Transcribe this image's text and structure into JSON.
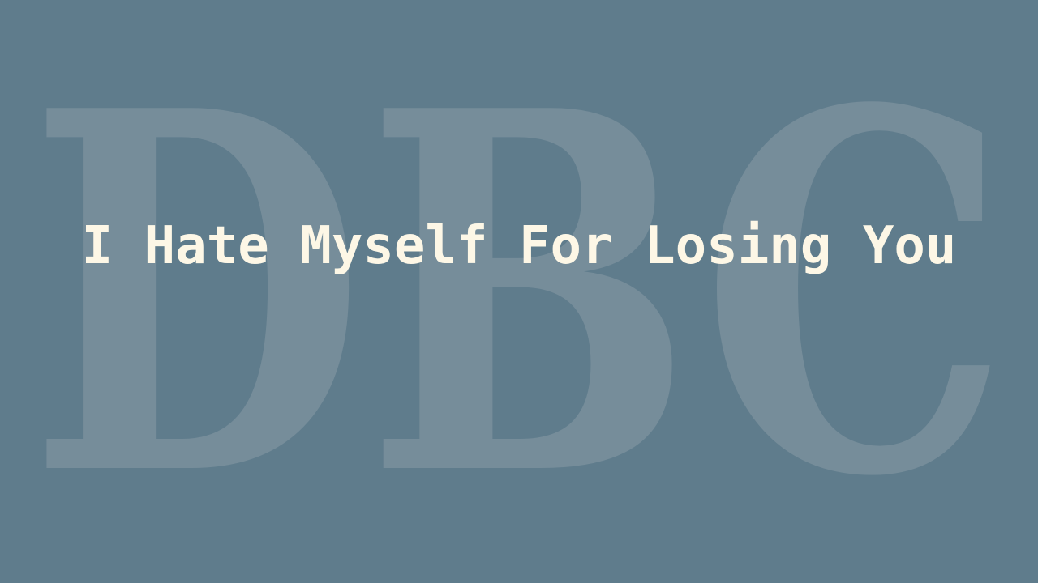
{
  "slide": {
    "watermark_text": "DBC",
    "title": "I Hate Myself For Losing You"
  },
  "colors": {
    "background": "#5f7c8c",
    "watermark": "#768d9a",
    "title": "#fdf7e6"
  }
}
